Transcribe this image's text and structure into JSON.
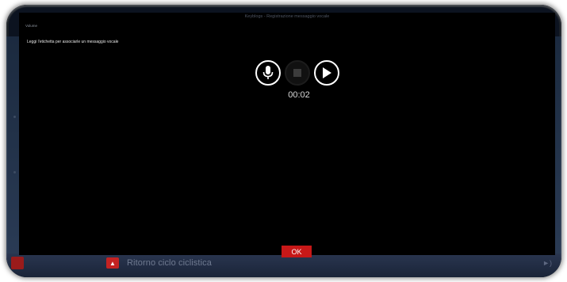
{
  "dialog": {
    "title": "Keyblogs - Registrazione messaggio vocale",
    "head_label": "Volume",
    "instruction": "Leggi l'etichetta per associarle un messaggio vocale",
    "timer": "00:02",
    "ok_label": "OK"
  },
  "controls": [
    {
      "name": "record",
      "icon": "microphone-icon"
    },
    {
      "name": "stop",
      "icon": "stop-icon"
    },
    {
      "name": "play",
      "icon": "play-icon"
    }
  ],
  "bottom_bar": {
    "label": "Ritorno ciclo ciclistica",
    "volume_icon": "speaker-icon"
  },
  "colors": {
    "accent_red": "#c71818",
    "dialog_bg": "#000000",
    "app_bg": "#0c1320"
  }
}
